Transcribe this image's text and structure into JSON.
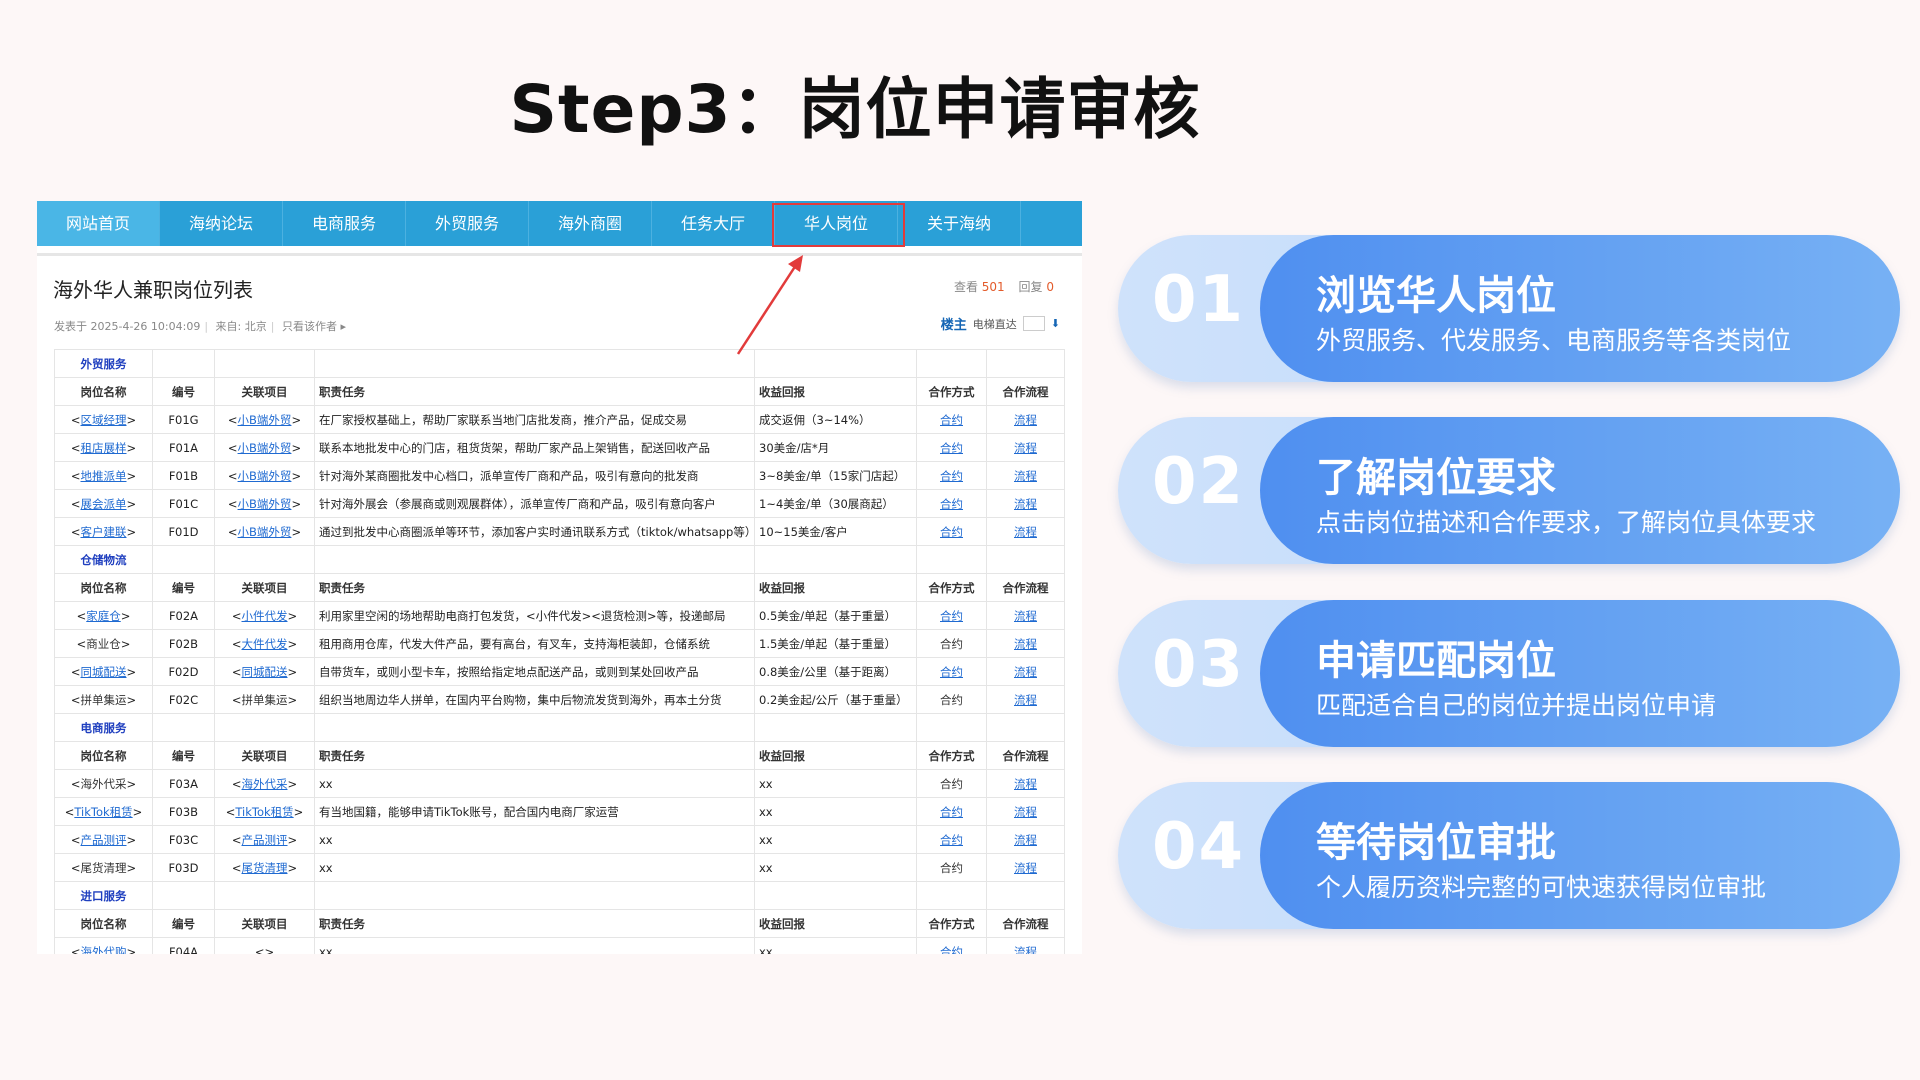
{
  "slide": {
    "title": "Step3：岗位申请审核"
  },
  "nav": [
    {
      "label": "网站首页"
    },
    {
      "label": "海纳论坛"
    },
    {
      "label": "电商服务"
    },
    {
      "label": "外贸服务"
    },
    {
      "label": "海外商圈"
    },
    {
      "label": "任务大厅"
    },
    {
      "label": "华人岗位"
    },
    {
      "label": "关于海纳"
    }
  ],
  "post": {
    "title": "海外华人兼职岗位列表",
    "views_label": "查看",
    "views": "501",
    "replies_label": "回复",
    "replies": "0",
    "posted": "发表于 2025-4-26 10:04:09",
    "from": "来自: 北京",
    "only_author": "只看该作者",
    "author_tag": "楼主",
    "jump_label": "电梯直达"
  },
  "table": {
    "headers": [
      "岗位名称",
      "编号",
      "关联项目",
      "职责任务",
      "收益回报",
      "合作方式",
      "合作流程"
    ],
    "sections": [
      {
        "name": "外贸服务",
        "rows": [
          {
            "name": "区域经理",
            "name_link": true,
            "code": "F01G",
            "project": "小B端外贸",
            "project_link": true,
            "duty": "在厂家授权基础上，帮助厂家联系当地门店批发商，推介产品，促成交易",
            "reward": "成交返佣（3~14%）",
            "coop": "合约",
            "coop_link": true,
            "flow": "流程"
          },
          {
            "name": "租店展样",
            "name_link": true,
            "code": "F01A",
            "project": "小B端外贸",
            "project_link": true,
            "duty": "联系本地批发中心的门店，租货货架，帮助厂家产品上架销售，配送回收产品",
            "reward": "30美金/店*月",
            "coop": "合约",
            "coop_link": true,
            "flow": "流程"
          },
          {
            "name": "地推派单",
            "name_link": true,
            "code": "F01B",
            "project": "小B端外贸",
            "project_link": true,
            "duty": "针对海外某商圈批发中心档口，派单宣传厂商和产品，吸引有意向的批发商",
            "reward": "3~8美金/单（15家门店起）",
            "coop": "合约",
            "coop_link": true,
            "flow": "流程"
          },
          {
            "name": "展会派单",
            "name_link": true,
            "code": "F01C",
            "project": "小B端外贸",
            "project_link": true,
            "duty": "针对海外展会（参展商或则观展群体），派单宣传厂商和产品，吸引有意向客户",
            "reward": "1~4美金/单（30展商起）",
            "coop": "合约",
            "coop_link": true,
            "flow": "流程"
          },
          {
            "name": "客户建联",
            "name_link": true,
            "code": "F01D",
            "project": "小B端外贸",
            "project_link": true,
            "duty": "通过到批发中心商圈派单等环节，添加客户实时通讯联系方式（tiktok/whatsapp等）",
            "reward": "10~15美金/客户",
            "coop": "合约",
            "coop_link": true,
            "flow": "流程"
          }
        ]
      },
      {
        "name": "仓储物流",
        "rows": [
          {
            "name": "家庭仓",
            "name_link": true,
            "code": "F02A",
            "project": "小件代发",
            "project_link": true,
            "duty": "利用家里空闲的场地帮助电商打包发货，<小件代发><退货检测>等，投递邮局",
            "reward": "0.5美金/单起（基于重量）",
            "coop": "合约",
            "coop_link": true,
            "flow": "流程"
          },
          {
            "name": "商业仓",
            "name_link": false,
            "code": "F02B",
            "project": "大件代发",
            "project_link": true,
            "duty": "租用商用仓库，代发大件产品，要有高台，有叉车，支持海柜装卸，仓储系统",
            "reward": "1.5美金/单起（基于重量）",
            "coop": "合约",
            "coop_link": false,
            "flow": "流程"
          },
          {
            "name": "同城配送",
            "name_link": true,
            "code": "F02D",
            "project": "同城配送",
            "project_link": true,
            "duty": "自带货车，或则小型卡车，按照给指定地点配送产品，或则到某处回收产品",
            "reward": "0.8美金/公里（基于距离）",
            "coop": "合约",
            "coop_link": true,
            "flow": "流程"
          },
          {
            "name": "拼单集运",
            "name_link": false,
            "code": "F02C",
            "project": "拼单集运",
            "project_link": false,
            "duty": "组织当地周边华人拼单，在国内平台购物，集中后物流发货到海外，再本土分货",
            "reward": "0.2美金起/公斤（基于重量）",
            "coop": "合约",
            "coop_link": false,
            "flow": "流程"
          }
        ]
      },
      {
        "name": "电商服务",
        "rows": [
          {
            "name": "海外代采",
            "name_link": false,
            "code": "F03A",
            "project": "海外代采",
            "project_link": true,
            "duty": "xx",
            "reward": "xx",
            "coop": "合约",
            "coop_link": false,
            "flow": "流程"
          },
          {
            "name": "TikTok租赁",
            "name_link": true,
            "code": "F03B",
            "project": "TikTok租赁",
            "project_link": true,
            "duty": "有当地国籍，能够申请TikTok账号，配合国内电商厂家运营",
            "reward": "xx",
            "coop": "合约",
            "coop_link": true,
            "flow": "流程"
          },
          {
            "name": "产品测评",
            "name_link": true,
            "code": "F03C",
            "project": "产品测评",
            "project_link": true,
            "duty": "xx",
            "reward": "xx",
            "coop": "合约",
            "coop_link": true,
            "flow": "流程"
          },
          {
            "name": "尾货清理",
            "name_link": false,
            "code": "F03D",
            "project": "尾货清理",
            "project_link": true,
            "duty": "xx",
            "reward": "xx",
            "coop": "合约",
            "coop_link": false,
            "flow": "流程"
          }
        ]
      },
      {
        "name": "进口服务",
        "rows": [
          {
            "name": "海外代购",
            "name_link": true,
            "code": "F04A",
            "project": "",
            "project_link": false,
            "duty": "xx",
            "reward": "xx",
            "coop": "合约",
            "coop_link": true,
            "flow": "流程"
          }
        ]
      }
    ]
  },
  "steps": [
    {
      "num": "01",
      "title": "浏览华人岗位",
      "desc": "外贸服务、代发服务、电商服务等各类岗位"
    },
    {
      "num": "02",
      "title": "了解岗位要求",
      "desc": "点击岗位描述和合作要求，了解岗位具体要求"
    },
    {
      "num": "03",
      "title": "申请匹配岗位",
      "desc": "匹配适合自己的岗位并提出岗位申请"
    },
    {
      "num": "04",
      "title": "等待岗位审批",
      "desc": "个人履历资料完整的可快速获得岗位审批"
    }
  ],
  "colors": {
    "nav": "#2aa0d7",
    "link": "#1f6ad1",
    "section": "#1f3fbf",
    "step_dark": "#4f8ff0",
    "step_light": "#cfe2fb",
    "highlight": "#e23b3b"
  }
}
